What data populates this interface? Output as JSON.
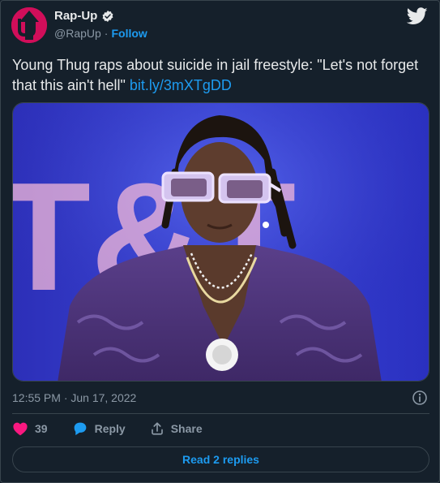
{
  "account": {
    "name": "Rap-Up",
    "handle": "@RapUp",
    "separator": "·",
    "follow_label": "Follow"
  },
  "tweet": {
    "text": "Young Thug raps about suicide in jail freestyle: \"Let's not forget that this ain't hell\" ",
    "link": "bit.ly/3mXTgDD",
    "timestamp": "12:55 PM · Jun 17, 2022"
  },
  "media": {
    "background_text": "T&T"
  },
  "actions": {
    "like_count": "39",
    "reply_label": "Reply",
    "share_label": "Share"
  },
  "read_replies_label": "Read 2 replies",
  "colors": {
    "background": "#15202b",
    "accent": "#1d9bf0",
    "like": "#f91880",
    "verified": "#e7e9ea",
    "avatar": "#d10e5a"
  },
  "icons": {
    "bird": "twitter-bird-icon",
    "verified": "verified-badge-icon",
    "info": "info-icon",
    "like": "heart-icon",
    "reply": "reply-bubble-icon",
    "share": "share-icon"
  }
}
